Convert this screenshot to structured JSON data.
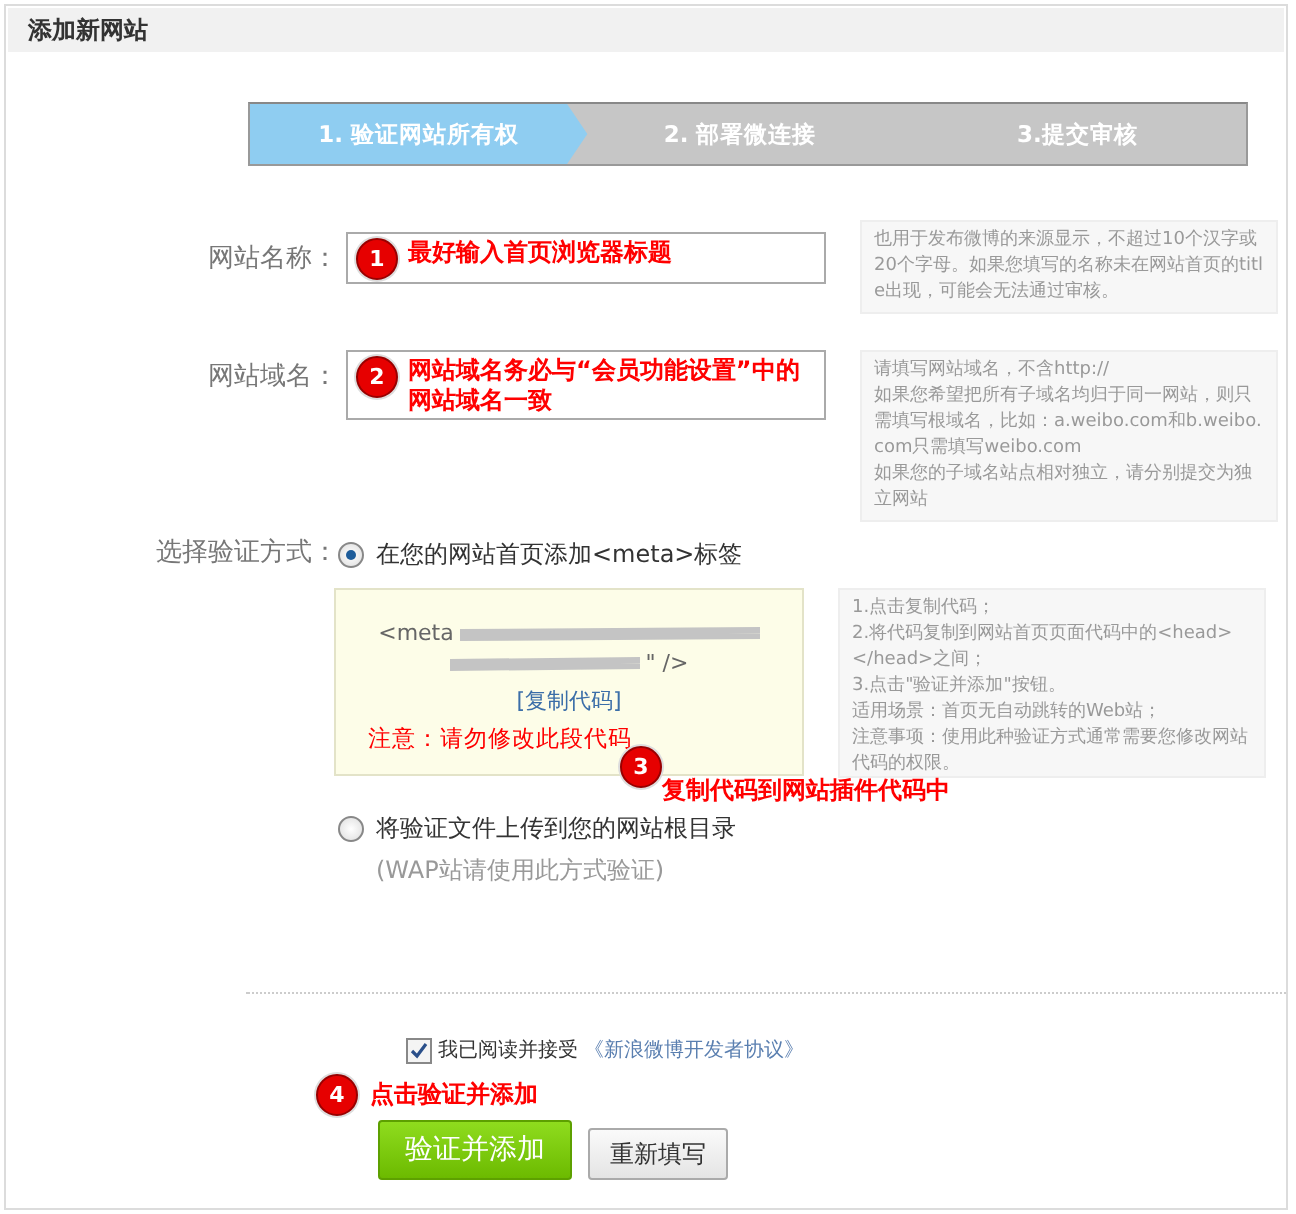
{
  "header": {
    "title": "添加新网站"
  },
  "steps": [
    {
      "label": "1. 验证网站所有权",
      "selected": true
    },
    {
      "label": "2. 部署微连接",
      "selected": false
    },
    {
      "label": "3.提交审核",
      "selected": false
    }
  ],
  "fields": [
    {
      "label": "网站名称：",
      "hint": [
        "也用于发布微博的来源显示，不超过10个汉字或20个字母。如果您填写的名称未在网站首页的title出现，可能会无法通过审核。"
      ],
      "annotation": {
        "number": "1",
        "text": "最好输入首页浏览器标题"
      }
    },
    {
      "label": "网站域名：",
      "hint": [
        "请填写网站域名，不含http://",
        "如果您希望把所有子域名均归于同一网站，则只需填写根域名，比如：a.weibo.com和b.weibo.com只需填写weibo.com",
        "如果您的子域名站点相对独立，请分别提交为独立网站"
      ],
      "annotation": {
        "number": "2",
        "text": "网站域名务必与“会员功能设置”中的网站域名一致"
      }
    }
  ],
  "verify": {
    "label": "选择验证方式：",
    "options": [
      {
        "label": "在您的网站首页添加<meta>标签",
        "selected": true
      },
      {
        "label": "将验证文件上传到您的网站根目录",
        "note": "(WAP站请使用此方式验证)",
        "selected": false
      }
    ],
    "code_box": {
      "code_start": "<meta",
      "code_end": "\" />",
      "copy_link": "[复制代码]",
      "warning": "注意：请勿修改此段代码"
    },
    "hint": [
      "1.点击复制代码；",
      "2.将代码复制到网站首页页面代码中的<head></head>之间；",
      "3.点击\"验证并添加\"按钮。",
      "适用场景：首页无自动跳转的Web站；",
      "注意事项：使用此种验证方式通常需要您修改网站代码的权限。"
    ],
    "annotation": {
      "number": "3",
      "text": "复制代码到网站插件代码中"
    }
  },
  "agreement": {
    "checked": true,
    "text": "我已阅读并接受",
    "link": "《新浪微博开发者协议》"
  },
  "annotation": {
    "number": "4",
    "text": "点击验证并添加"
  },
  "buttons": [
    {
      "label": "验证并添加",
      "kind": "primary"
    },
    {
      "label": "重新填写",
      "kind": "secondary"
    }
  ]
}
